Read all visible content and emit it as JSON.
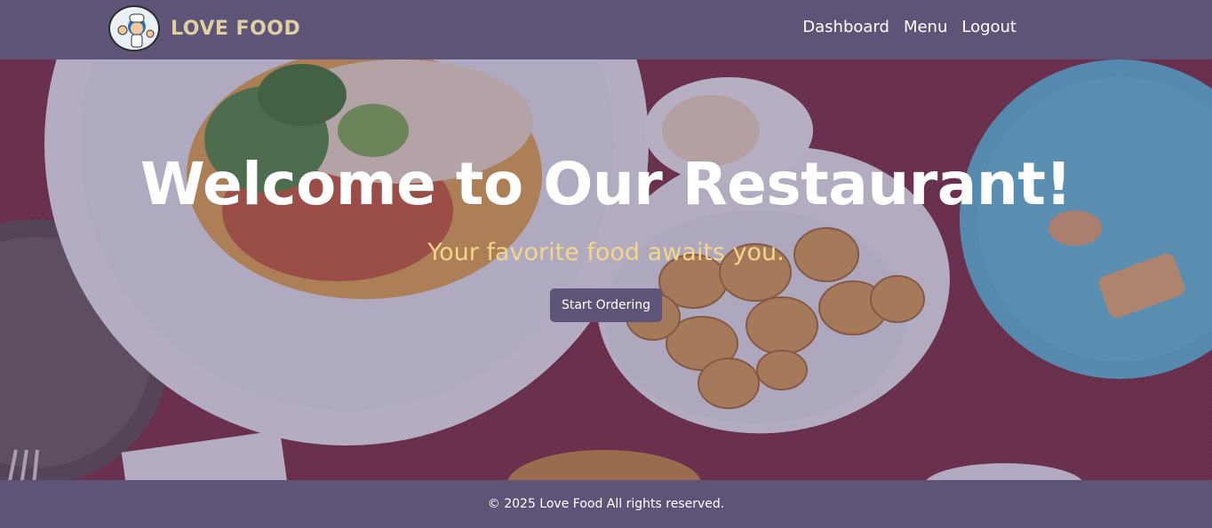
{
  "brand": {
    "name": "LOVE FOOD",
    "logo_icon": "chef-mascot-icon"
  },
  "nav": {
    "items": [
      {
        "label": "Dashboard"
      },
      {
        "label": "Menu"
      },
      {
        "label": "Logout"
      }
    ]
  },
  "hero": {
    "title": "Welcome to Our Restaurant!",
    "subtitle": "Your favorite food awaits you.",
    "cta_label": "Start Ordering",
    "background_image": "table-with-food-plates"
  },
  "footer": {
    "text": "© 2025 Love Food All rights reserved."
  },
  "colors": {
    "primary": "#5e5478",
    "subtitle": "#f5d58a",
    "brand_text": "#e0cfa0"
  }
}
